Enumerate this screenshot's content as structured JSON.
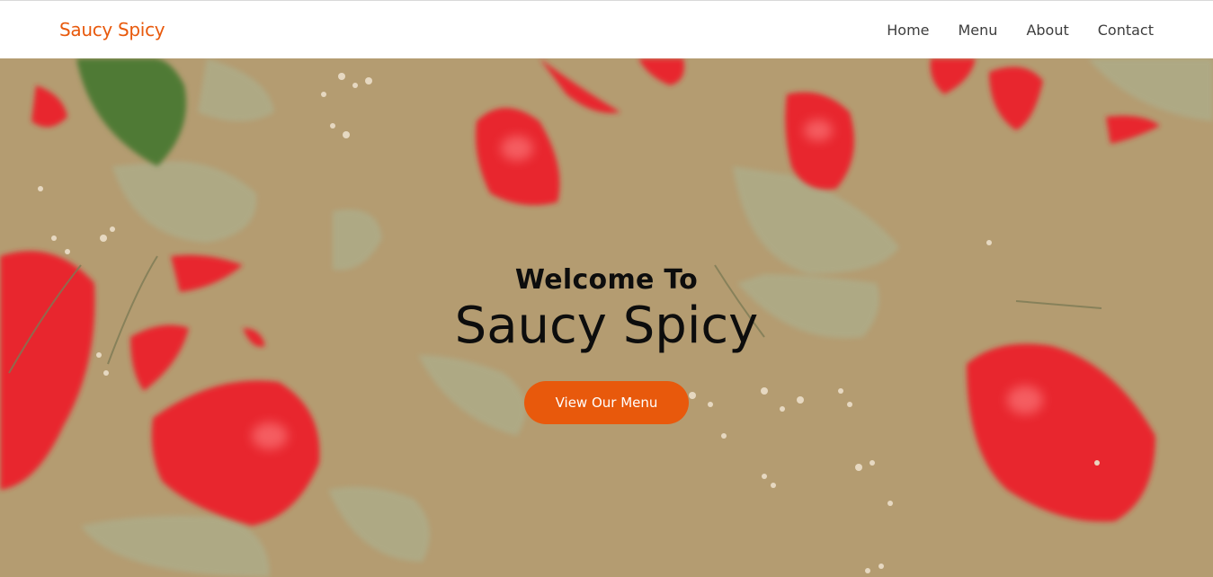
{
  "brand": {
    "name": "Saucy Spicy"
  },
  "nav": {
    "items": [
      {
        "label": "Home"
      },
      {
        "label": "Menu"
      },
      {
        "label": "About"
      },
      {
        "label": "Contact"
      }
    ]
  },
  "hero": {
    "welcome": "Welcome To",
    "title": "Saucy Spicy",
    "cta_label": "View Our Menu",
    "background_image": "photo of red rose petals, sage leaves and dried flowers floating in milky beige liquid"
  },
  "colors": {
    "accent": "#e8590c",
    "hero_background": "#b59d72",
    "petal": "#e8262f",
    "leaf": "#a9a885"
  }
}
